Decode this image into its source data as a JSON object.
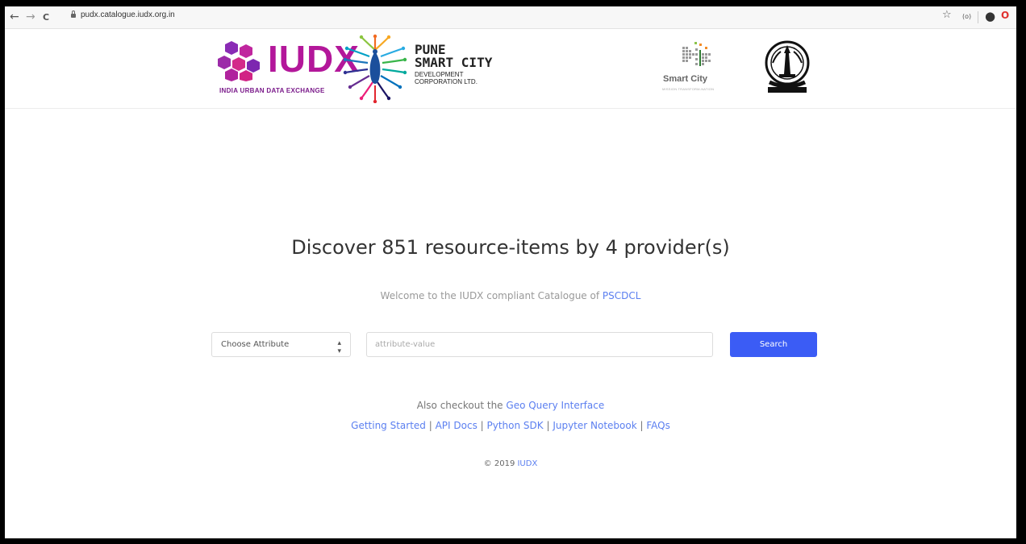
{
  "browser": {
    "back_icon": "←",
    "forward_icon": "→",
    "reload_icon": "C",
    "url": "pudx.catalogue.iudx.org.in",
    "star_icon": "☆",
    "ext_badge": "(o)",
    "account_icon": "●",
    "opera_icon": "O"
  },
  "logos": {
    "iudx_word": "IUDX",
    "iudx_sub": "INDIA URBAN DATA EXCHANGE",
    "pune_title_1": "PUNE",
    "pune_title_2": "SMART CITY",
    "pune_sub_1": "DEVELOPMENT",
    "pune_sub_2": "CORPORATION LTD.",
    "smart_city_word": "Smart City",
    "smart_city_tag": "MISSION TRANSFORM-NATION"
  },
  "main": {
    "headline": "Discover 851 resource-items by 4 provider(s)",
    "welcome_text": "Welcome to the IUDX compliant Catalogue of ",
    "welcome_link": "PSCDCL",
    "select_label": "Choose Attribute",
    "input_placeholder": "attribute-value",
    "search_label": "Search",
    "geo_text": "Also checkout the ",
    "geo_link": "Geo Query Interface",
    "links": {
      "getting_started": "Getting Started",
      "api_docs": "API Docs",
      "python_sdk": "Python SDK",
      "jupyter": "Jupyter Notebook",
      "faqs": "FAQs",
      "sep": " | "
    },
    "copyright_text": "© 2019 ",
    "copyright_link": "IUDX"
  },
  "colors": {
    "accent": "#3b5cf5",
    "link": "#5b7ff0",
    "iudx": "#b3179a"
  }
}
